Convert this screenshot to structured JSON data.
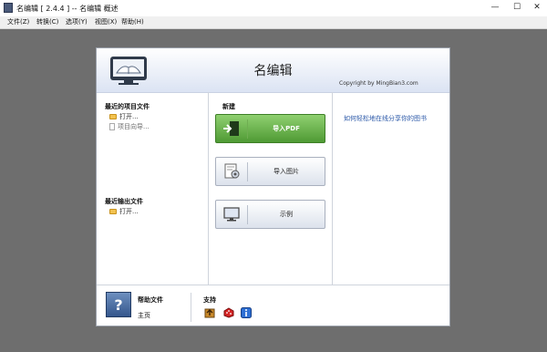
{
  "window": {
    "title": "名编辑 [ 2.4.4 ] -- 名编辑 概述",
    "minimize_glyph": "—",
    "maximize_glyph": "☐",
    "close_glyph": "✕"
  },
  "menu": [
    "文件(Z)",
    "转换(C)",
    "选项(Y)",
    "视图(X)",
    "帮助(H)"
  ],
  "header": {
    "app_title": "名编辑",
    "copyright": "Copyright by MingBian3.com",
    "logo_icon": "open-book-monitor-icon"
  },
  "left": {
    "recent_projects_title": "最近的项目文件",
    "recent_projects": [
      {
        "label": "打开...",
        "icon": "folder-icon"
      },
      {
        "label": "项目向导...",
        "icon": "document-icon"
      }
    ],
    "recent_output_title": "最近输出文件",
    "recent_output": [
      {
        "label": "打开...",
        "icon": "folder-icon"
      }
    ]
  },
  "center": {
    "new_title": "新建",
    "buttons": [
      {
        "label": "导入PDF",
        "icon": "import-arrow-icon",
        "style": "green"
      },
      {
        "label": "导入图片",
        "icon": "image-import-icon",
        "style": "normal"
      },
      {
        "label": "示例",
        "icon": "monitor-icon",
        "style": "normal"
      }
    ]
  },
  "right": {
    "help_link": "如何轻松地在线分享你的图书"
  },
  "footer": {
    "help_title": "帮助文件",
    "help_home": "主页",
    "help_icon_glyph": "?",
    "support_title": "支持",
    "support_icons": [
      "upload-icon",
      "dice-icon",
      "info-icon"
    ]
  },
  "colors": {
    "background": "#6e6e6e",
    "accent_green": "#4f9a34",
    "link_blue": "#2b58a8",
    "header_gradient_end": "#dbe3f3"
  }
}
